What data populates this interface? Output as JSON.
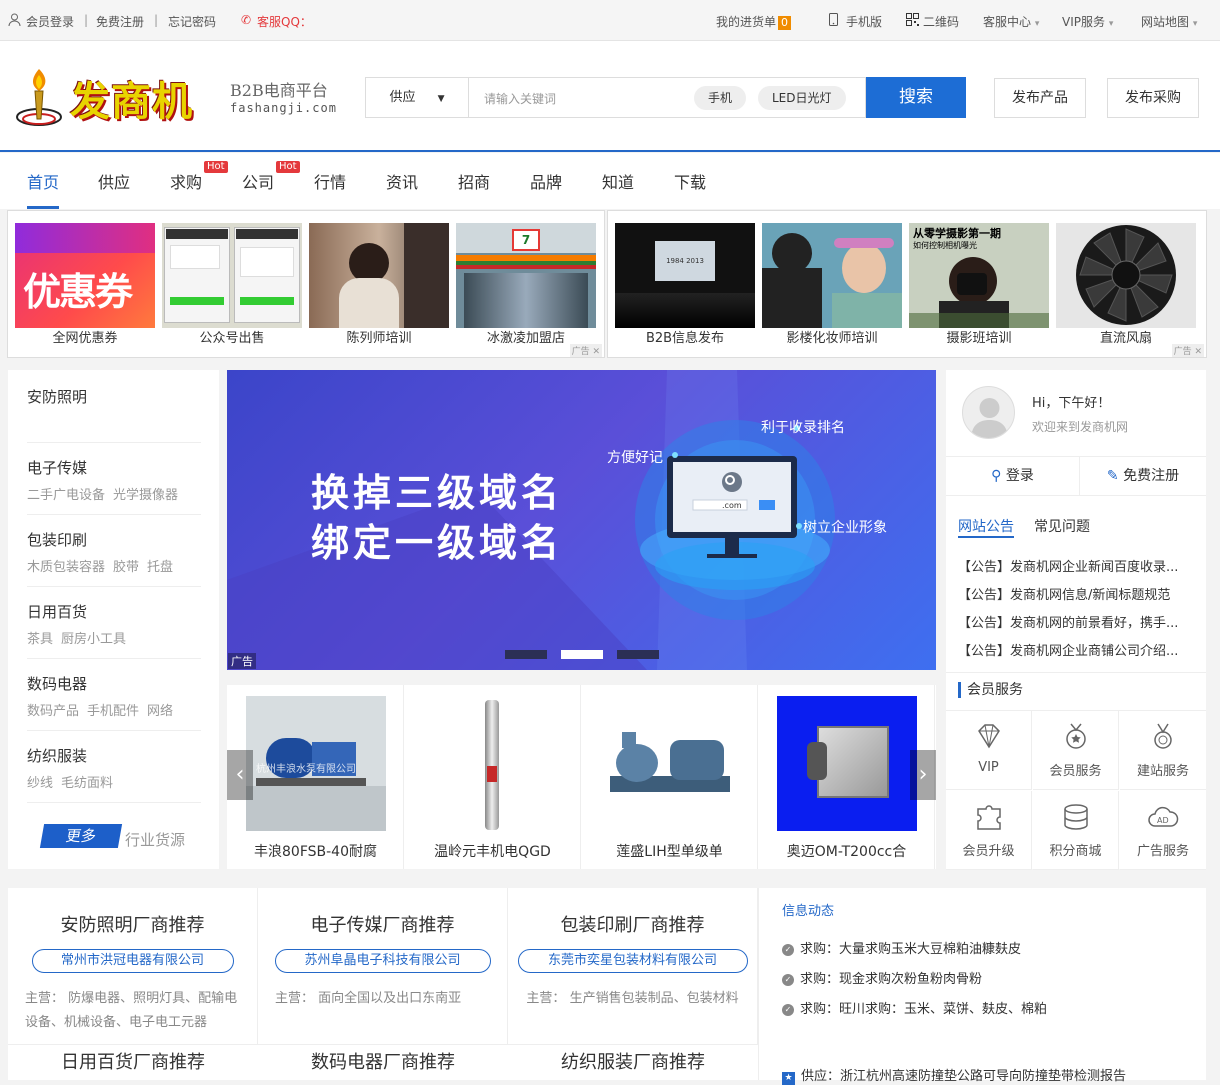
{
  "topbar": {
    "login": "会员登录",
    "register": "免费注册",
    "forgot": "忘记密码",
    "qq": "客服QQ：",
    "cart": "我的进货单",
    "cart_count": "0",
    "mobile": "手机版",
    "qrcode": "二维码",
    "service": "客服中心",
    "vip": "VIP服务",
    "sitemap": "网站地图"
  },
  "header": {
    "logo_text": "发商机",
    "tagline": "B2B电商平台",
    "domain": "fashangji.com",
    "search_type": "供应",
    "search_placeholder": "请输入关键词",
    "chips": [
      "手机",
      "LED日光灯"
    ],
    "search_button": "搜索",
    "publish_product": "发布产品",
    "publish_purchase": "发布采购"
  },
  "nav": {
    "items": [
      "首页",
      "供应",
      "求购",
      "公司",
      "行情",
      "资讯",
      "招商",
      "品牌",
      "知道",
      "下载"
    ],
    "hot_label": "Hot"
  },
  "ads_left": [
    "全网优惠券",
    "公众号出售",
    "陈列师培训",
    "冰激凌加盟店"
  ],
  "ads_right": [
    "B2B信息发布",
    "影楼化妆师培训",
    "摄影班培训",
    "直流风扇"
  ],
  "ad_tag": "广告",
  "ad_images": {
    "coupon_text": "优惠券",
    "photo_headline": "从零学摄影第一期",
    "photo_sub": "如何控制相机曝光",
    "stage_year": "1984 2013",
    "store_sign": "7-ELEVEN"
  },
  "categories": [
    {
      "name": "安防照明",
      "subs": []
    },
    {
      "name": "电子传媒",
      "subs": [
        "二手广电设备",
        "光学摄像器"
      ]
    },
    {
      "name": "包装印刷",
      "subs": [
        "木质包装容器",
        "胶带",
        "托盘"
      ]
    },
    {
      "name": "日用百货",
      "subs": [
        "茶具",
        "厨房小工具"
      ]
    },
    {
      "name": "数码电器",
      "subs": [
        "数码产品",
        "手机配件",
        "网络"
      ]
    },
    {
      "name": "纺织服装",
      "subs": [
        "纱线",
        "毛纺面料"
      ]
    }
  ],
  "more_button": "更多",
  "industry_source": "行业货源",
  "banner": {
    "line1": "换掉三级域名",
    "line2": "绑定一级域名",
    "label1": "利于收录排名",
    "label2": "方便好记",
    "label3": "树立企业形象",
    "screen_text": ".com",
    "ad_label": "广告"
  },
  "products": [
    "丰浪80FSB-40耐腐",
    "温岭元丰机电QGD",
    "莲盛LIH型单级单",
    "奥迈OM-T200cc合"
  ],
  "product_watermark": "杭州丰浪水泵有限公司",
  "user": {
    "greeting": "Hi，下午好！",
    "welcome": "欢迎来到发商机网",
    "login": "登录",
    "register": "免费注册"
  },
  "notice_tabs": [
    "网站公告",
    "常见问题"
  ],
  "notices": [
    "【公告】发商机网企业新闻百度收录...",
    "【公告】发商机网信息/新闻标题规范",
    "【公告】发商机网的前景看好，携手...",
    "【公告】发商机网企业商铺公司介绍..."
  ],
  "member_service_title": "会员服务",
  "member_services": [
    "VIP",
    "会员服务",
    "建站服务",
    "会员升级",
    "积分商城",
    "广告服务"
  ],
  "recommend": [
    {
      "title": "安防照明厂商推荐",
      "company": "常州市洪冠电器有限公司",
      "main_label": "主营：",
      "main": "防爆电器、照明灯具、配输电设备、机械设备、电子电工元器"
    },
    {
      "title": "电子传媒厂商推荐",
      "company": "苏州阜晶电子科技有限公司",
      "main_label": "主营：",
      "main": "面向全国以及出口东南亚"
    },
    {
      "title": "包装印刷厂商推荐",
      "company": "东莞市奕星包装材料有限公司",
      "main_label": "主营：",
      "main": "生产销售包装制品、包装材料"
    }
  ],
  "recommend_row2": [
    "日用百货厂商推荐",
    "数码电器厂商推荐",
    "纺织服装厂商推荐"
  ],
  "news": {
    "title": "信息动态",
    "items": [
      "求购：大量求购玉米大豆棉粕油糠麸皮",
      "求购：现金求购次粉鱼粉肉骨粉",
      "求购：旺川求购：玉米、菜饼、麸皮、棉粕"
    ],
    "supply": "供应：浙江杭州高速防撞垫公路可导向防撞垫带检测报告",
    "supply_icon": "★"
  },
  "colors": {
    "accent": "#2468c8",
    "red": "#e4393c",
    "button": "#1d6dd5"
  }
}
